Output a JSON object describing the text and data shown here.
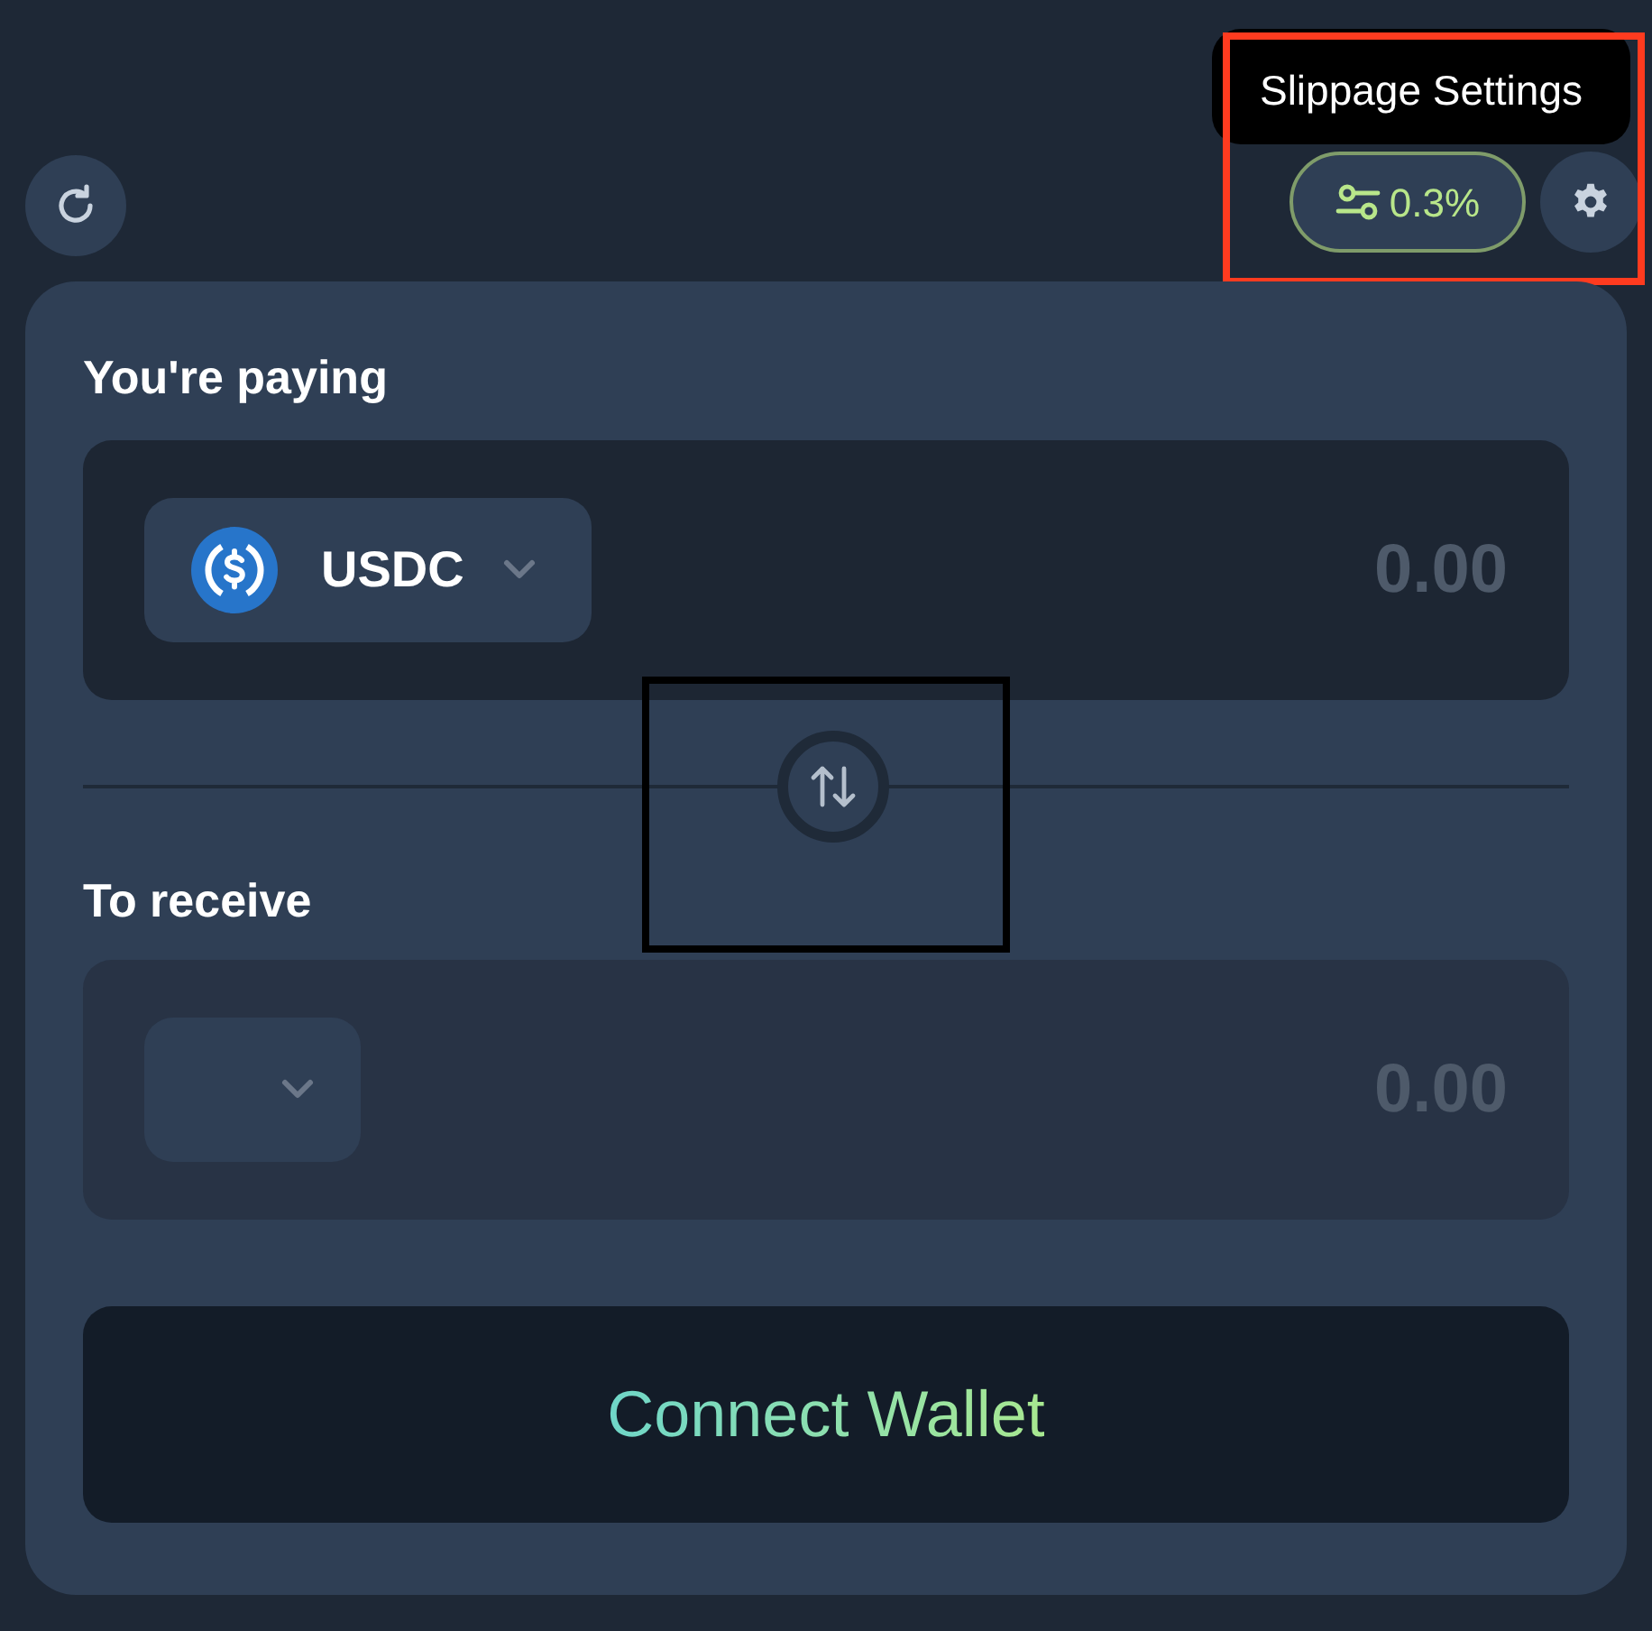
{
  "tooltip": {
    "text": "Slippage Settings"
  },
  "slippage": {
    "value": "0.3%"
  },
  "pay": {
    "label": "You're paying",
    "token": {
      "symbol": "USDC",
      "kind": "usdc"
    },
    "amount_placeholder": "0.00"
  },
  "receive": {
    "label": "To receive",
    "token": {
      "kind": "empty"
    },
    "amount_placeholder": "0.00"
  },
  "connect_button": {
    "label": "Connect Wallet"
  }
}
